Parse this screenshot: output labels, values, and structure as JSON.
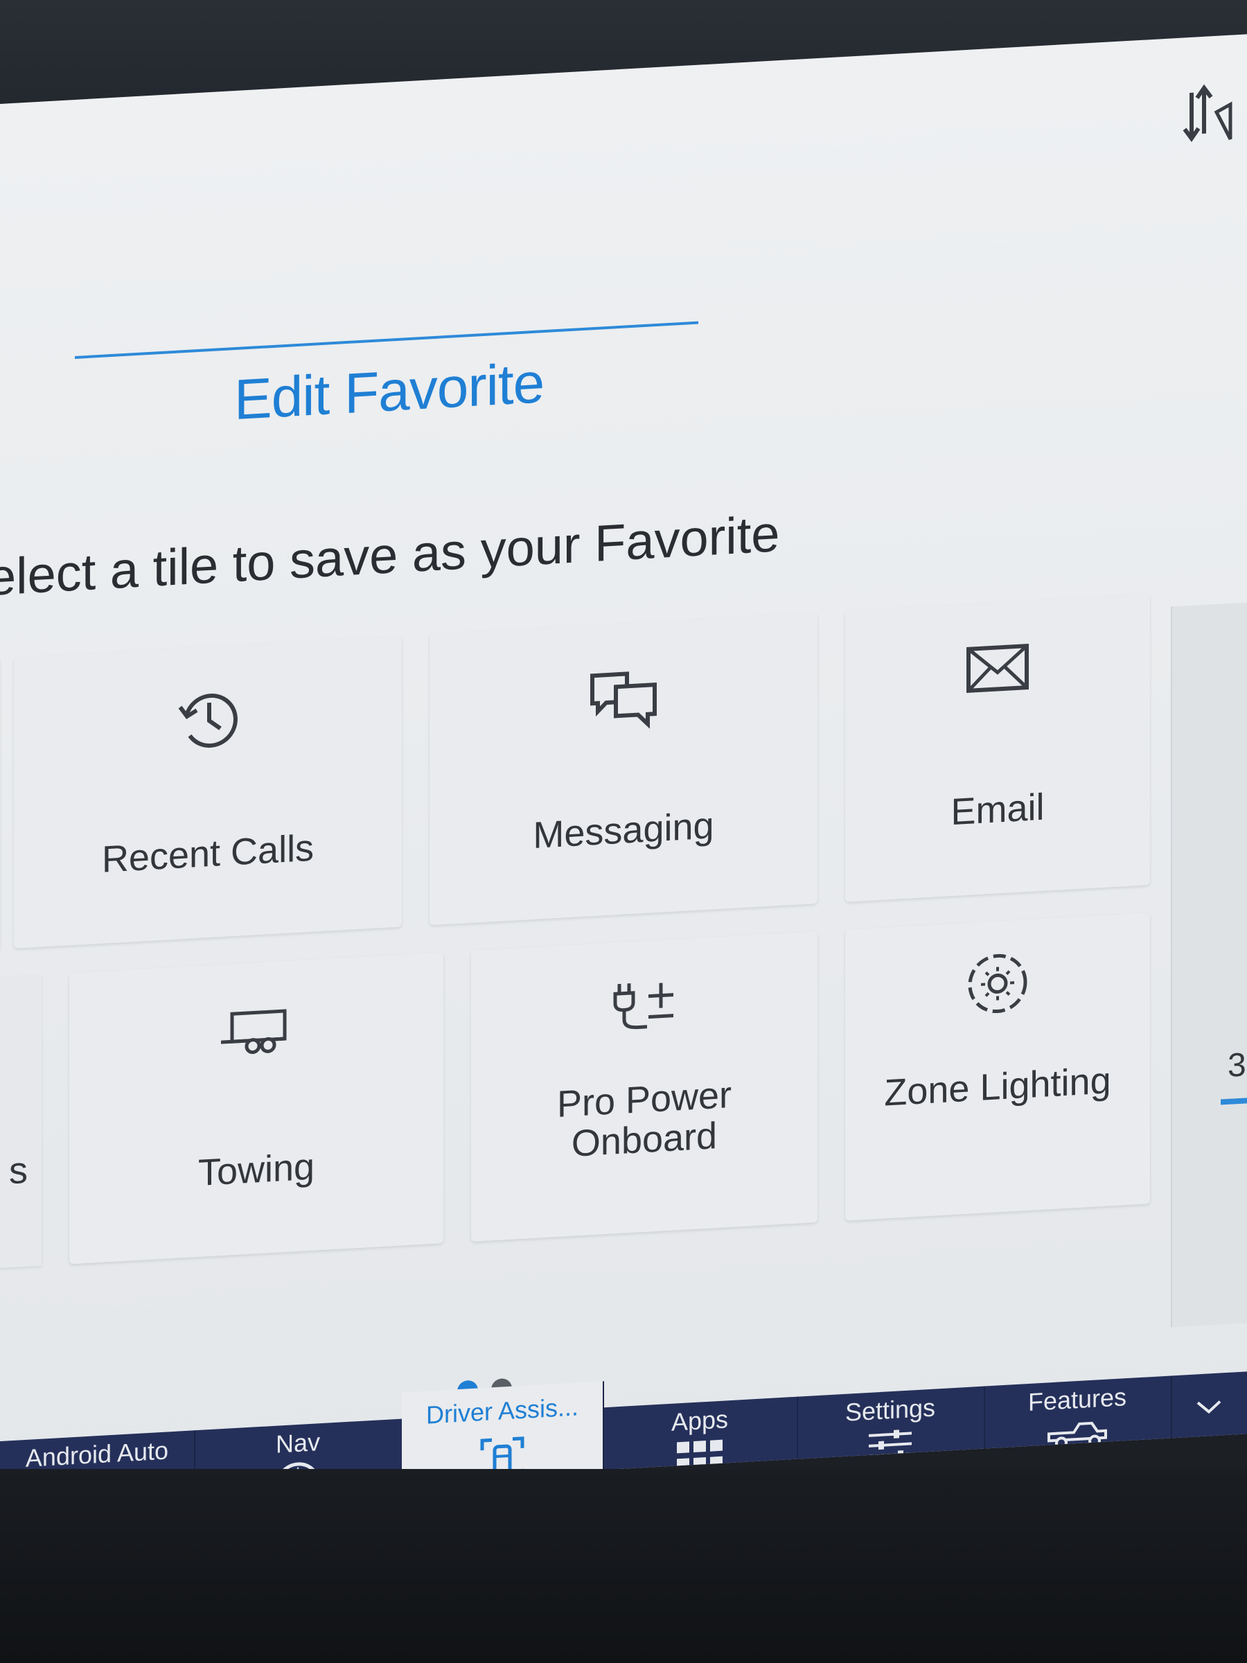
{
  "header": {
    "title": "Edit Favorite",
    "prompt": "elect a tile to save as your Favorite"
  },
  "tiles": [
    {
      "label": "Recent Calls",
      "icon": "clock-history-icon"
    },
    {
      "label": "Messaging",
      "icon": "chat-bubbles-icon"
    },
    {
      "label": "Email",
      "icon": "envelope-icon"
    },
    {
      "label": "Towing",
      "icon": "trailer-icon"
    },
    {
      "label": "Pro Power Onboard",
      "label_lines": [
        "Pro Power",
        "Onboard"
      ],
      "icon": "power-plug-icon"
    },
    {
      "label": "Zone Lighting",
      "icon": "zone-lighting-icon"
    }
  ],
  "partial_tile_label": "s",
  "right_panel": {
    "partial_number": "3"
  },
  "pagination": {
    "pages": 2,
    "current": 1
  },
  "navbar": {
    "items": [
      {
        "label": "Android Auto",
        "icon": "android-auto-icon",
        "active": false
      },
      {
        "label": "Nav",
        "icon": "navigation-arrow-icon",
        "active": false
      },
      {
        "label": "Driver Assis...",
        "icon": "driver-assist-icon",
        "active": true
      },
      {
        "label": "Apps",
        "icon": "apps-grid-icon",
        "active": false
      },
      {
        "label": "Settings",
        "icon": "sliders-icon",
        "active": false
      },
      {
        "label": "Features",
        "icon": "truck-icon",
        "active": false
      }
    ]
  },
  "colors": {
    "accent": "#1f7fd4",
    "screen_bg": "#eceef0",
    "navbar_bg": "#25305a",
    "tile_bg": "#e9ebee"
  }
}
